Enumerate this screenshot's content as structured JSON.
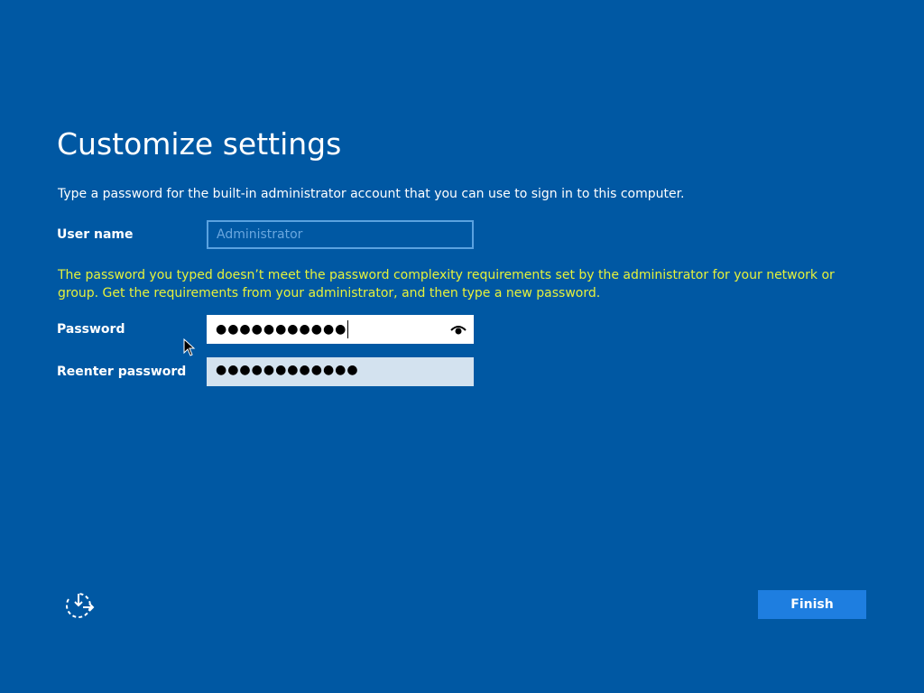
{
  "page": {
    "title": "Customize settings",
    "instructions": "Type a password for the built-in administrator account that you can use to sign in to this computer."
  },
  "form": {
    "username_label": "User name",
    "username_placeholder": "Administrator",
    "error_message": "The password you typed doesn’t meet the password complexity requirements set by the administrator for your network or group. Get the requirements from your administrator, and then type a new password.",
    "password_label": "Password",
    "password_value": "●●●●●●●●●●●",
    "reenter_label": "Reenter password",
    "reenter_value": "●●●●●●●●●●●●"
  },
  "footer": {
    "finish_label": "Finish",
    "accessibility_icon": "ease-of-access-icon"
  },
  "colors": {
    "background": "#0058a3",
    "error_text": "#e6f13b",
    "button": "#1e7ee0"
  }
}
